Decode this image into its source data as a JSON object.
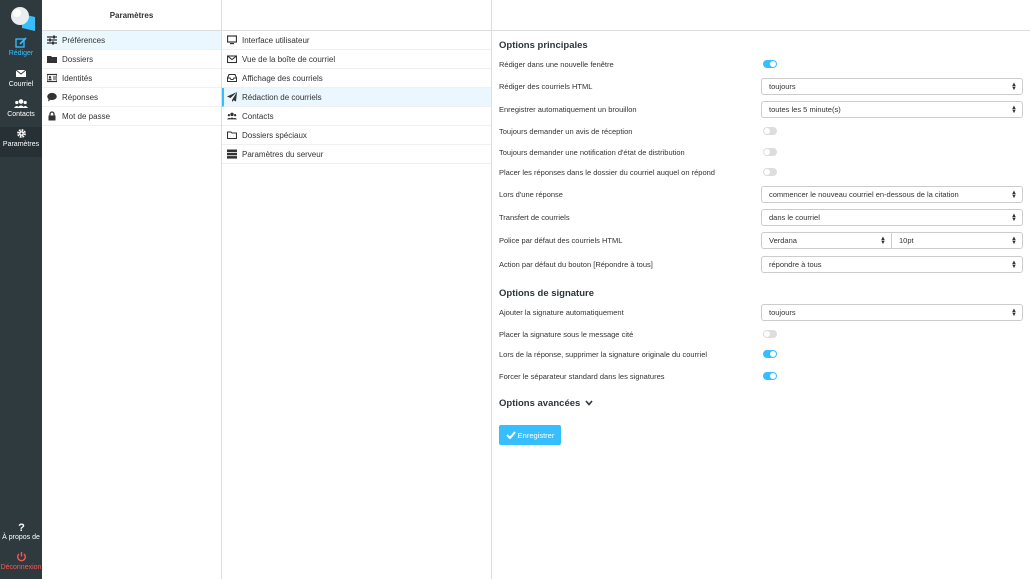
{
  "nav": {
    "compose": "Rédiger",
    "mail": "Courriel",
    "contacts": "Contacts",
    "settings": "Paramètres",
    "about": "À propos de",
    "logout": "Déconnexion"
  },
  "col1": {
    "title": "Paramètres",
    "items": [
      "Préférences",
      "Dossiers",
      "Identités",
      "Réponses",
      "Mot de passe"
    ]
  },
  "col2": {
    "items": [
      "Interface utilisateur",
      "Vue de la boîte de courriel",
      "Affichage des courriels",
      "Rédaction de courriels",
      "Contacts",
      "Dossiers spéciaux",
      "Paramètres du serveur"
    ]
  },
  "main": {
    "section1": "Options principales",
    "rows": [
      {
        "label": "Rédiger dans une nouvelle fenêtre"
      },
      {
        "label": "Rédiger des courriels HTML",
        "value": "toujours"
      },
      {
        "label": "Enregistrer automatiquement un brouillon",
        "value": "toutes les 5 minute(s)"
      },
      {
        "label": "Toujours demander un avis de réception"
      },
      {
        "label": "Toujours demander une notification d'état de distribution"
      },
      {
        "label": "Placer les réponses dans le dossier du courriel auquel on répond"
      },
      {
        "label": "Lors d'une réponse",
        "value": "commencer le nouveau courriel en-dessous de la citation"
      },
      {
        "label": "Transfert de courriels",
        "value": "dans le courriel"
      },
      {
        "label": "Police par défaut des courriels HTML",
        "value": "Verdana",
        "value2": "10pt"
      },
      {
        "label": "Action par défaut du bouton [Répondre à tous]",
        "value": "répondre à tous"
      }
    ],
    "section2": "Options de signature",
    "sigrows": [
      {
        "label": "Ajouter la signature automatiquement",
        "value": "toujours"
      },
      {
        "label": "Placer la signature sous le message cité"
      },
      {
        "label": "Lors de la réponse, supprimer la signature originale du courriel"
      },
      {
        "label": "Forcer le séparateur standard dans les signatures"
      }
    ],
    "advanced": "Options avancées",
    "save": "Enregistrer"
  },
  "colors": {
    "accent": "#37beff",
    "nav_bg": "#2f3a3f",
    "logout": "#ff5552",
    "selected_bg": "#ebf7ff"
  }
}
